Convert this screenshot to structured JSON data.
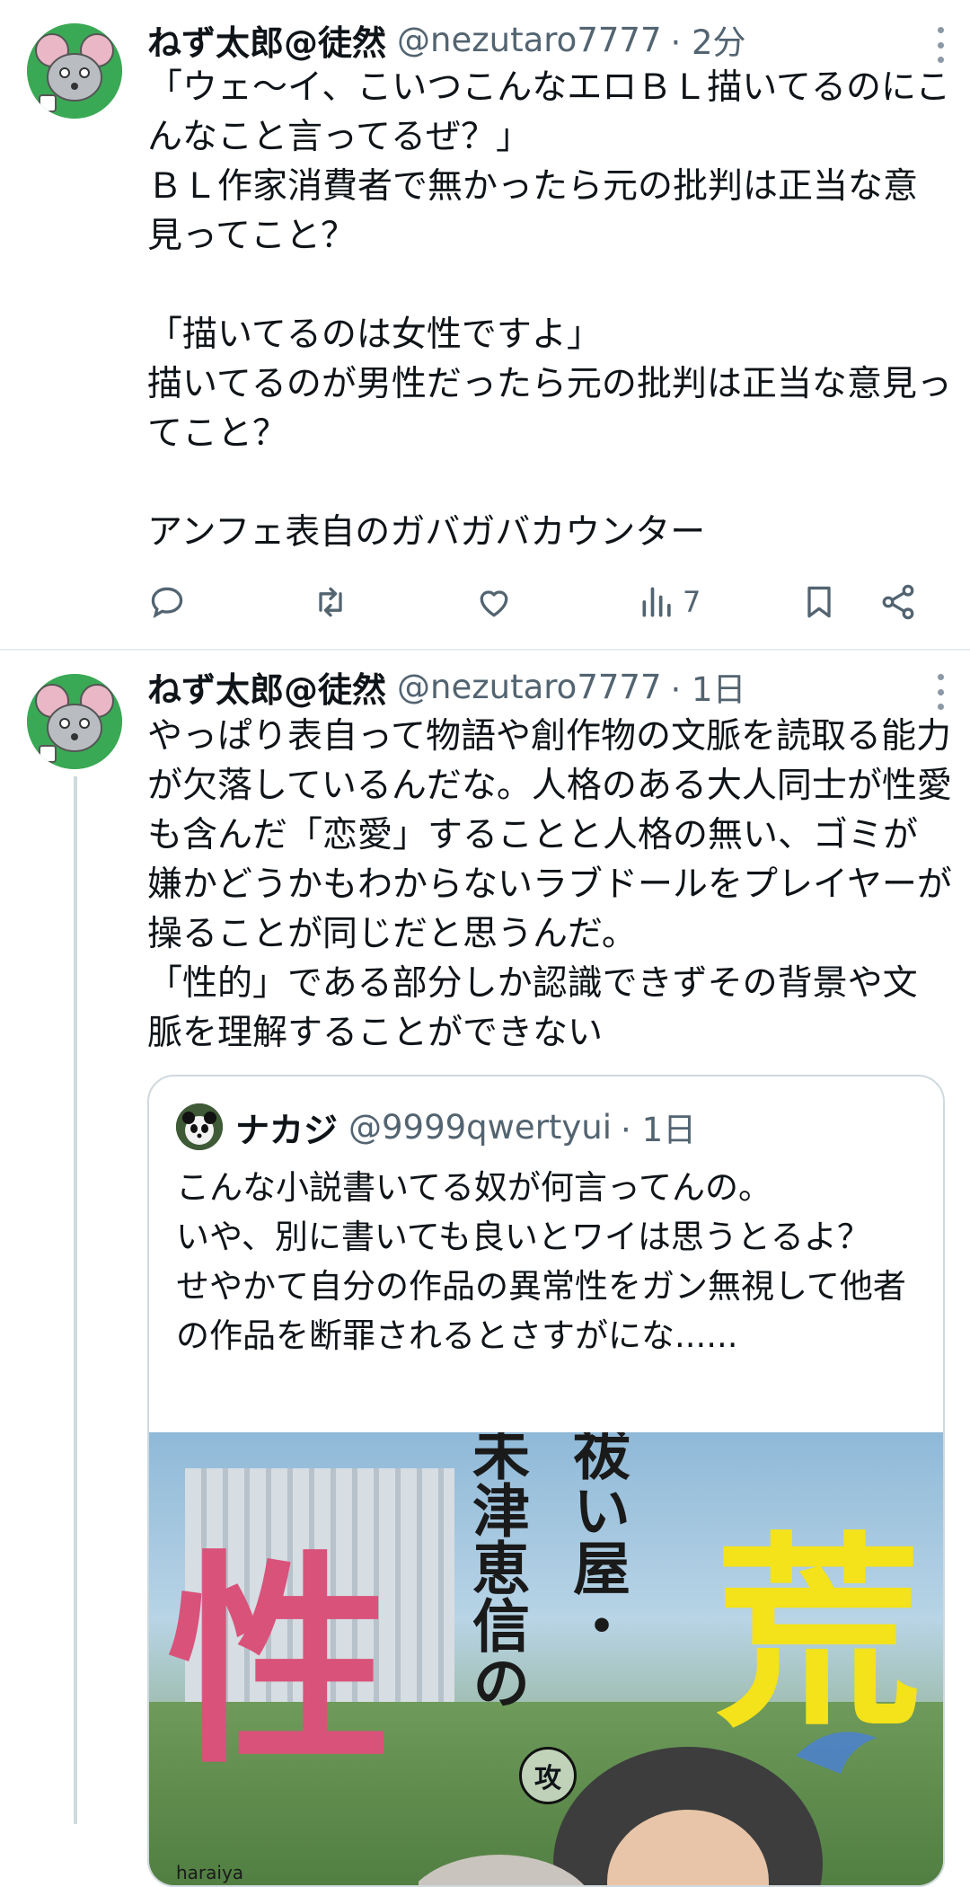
{
  "tweets": [
    {
      "name": "ねず太郎@徒然",
      "handle": "@nezutaro7777",
      "time": "· 2分",
      "text": "「ウェ〜イ、こいつこんなエロＢＬ描いてるのにこんなこと言ってるぜ？」\nＢＬ作家消費者で無かったら元の批判は正当な意見ってこと？\n\n「描いてるのは女性ですよ」\n描いてるのが男性だったら元の批判は正当な意見ってこと？\n\nアンフェ表自のガバガバカウンター",
      "views": "7"
    },
    {
      "name": "ねず太郎@徒然",
      "handle": "@nezutaro7777",
      "time": "· 1日",
      "text": "やっぱり表自って物語や創作物の文脈を読取る能力が欠落しているんだな。人格のある大人同士が性愛も含んだ「恋愛」することと人格の無い、ゴミが嫌かどうかもわからないラブドールをプレイヤーが操ることが同じだと思うんだ。\n「性的」である部分しか認識できずその背景や文脈を理解することができない"
    }
  ],
  "quote": {
    "name": "ナカジ",
    "handle": "@9999qwertyui",
    "time": "· 1日",
    "text": "こんな小説書いてる奴が何言ってんの。\nいや、別に書いても良いとワイは思うとるよ？\nせやかて自分の作品の異常性をガン無視して他者の作品を断罪されるとさすがにな......",
    "image": {
      "title_vertical_1": "祓い屋・",
      "title_vertical_2": "未津恵信の",
      "title_large_left": "性",
      "title_large_right": "荒",
      "badge": "攻",
      "credit": "haraiya"
    }
  },
  "colors": {
    "avatar_bg": "#3aa955",
    "secondary_text": "#536471",
    "border": "#cfd9de"
  },
  "icons": [
    "reply-icon",
    "retweet-icon",
    "like-icon",
    "views-icon",
    "bookmark-icon",
    "share-icon",
    "more-icon"
  ]
}
